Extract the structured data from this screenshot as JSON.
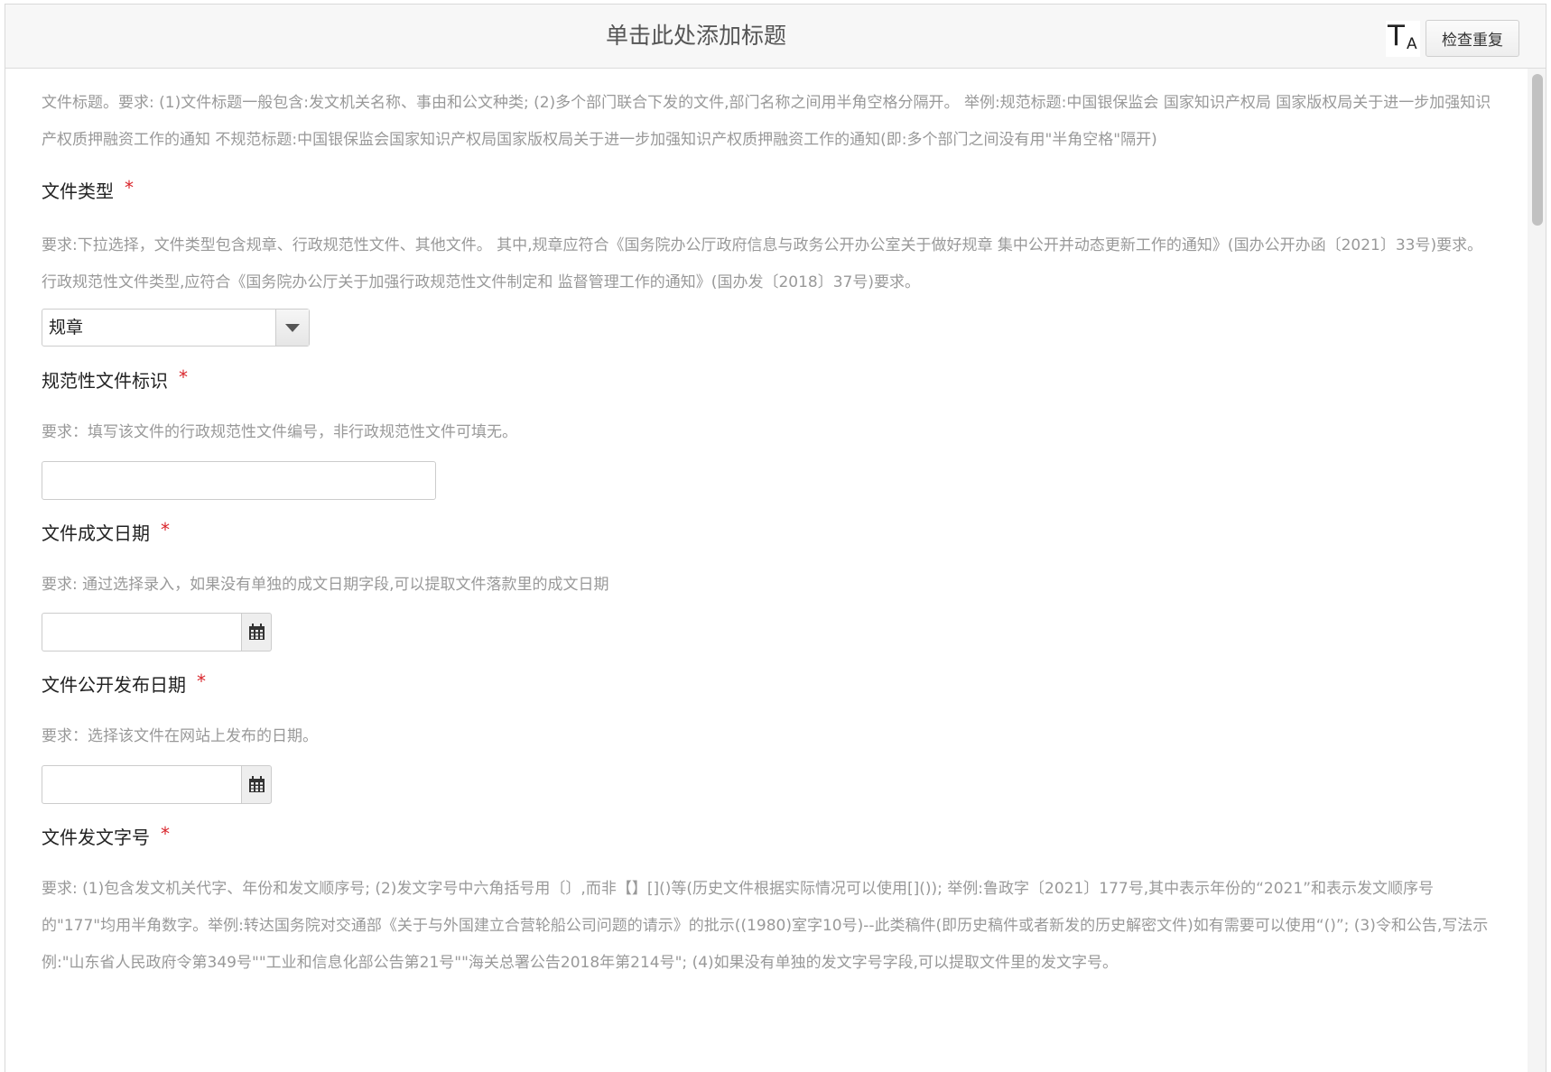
{
  "header": {
    "title": "单击此处添加标题",
    "font_toggle_big": "T",
    "font_toggle_small": "A",
    "check_duplicate_label": "检查重复"
  },
  "form": {
    "title_hint": "文件标题。要求: (1)文件标题一般包含:发文机关名称、事由和公文种类; (2)多个部门联合下发的文件,部门名称之间用半角空格分隔开。 举例:规范标题:中国银保监会 国家知识产权局 国家版权局关于进一步加强知识产权质押融资工作的通知 不规范标题:中国银保监会国家知识产权局国家版权局关于进一步加强知识产权质押融资工作的通知(即:多个部门之间没有用\"半角空格\"隔开)",
    "fields": {
      "doc_type": {
        "label": "文件类型",
        "required_mark": "*",
        "hint": "要求:下拉选择，文件类型包含规章、行政规范性文件、其他文件。 其中,规章应符合《国务院办公厅政府信息与政务公开办公室关于做好规章 集中公开并动态更新工作的通知》(国办公开办函〔2021〕33号)要求。行政规范性文件类型,应符合《国务院办公厅关于加强行政规范性文件制定和 监督管理工作的通知》(国办发〔2018〕37号)要求。",
        "selected_value": "规章"
      },
      "normative_id": {
        "label": "规范性文件标识",
        "required_mark": "*",
        "hint": "要求：填写该文件的行政规范性文件编号，非行政规范性文件可填无。",
        "value": ""
      },
      "written_date": {
        "label": "文件成文日期",
        "required_mark": "*",
        "hint": "要求: 通过选择录入，如果没有单独的成文日期字段,可以提取文件落款里的成文日期",
        "value": ""
      },
      "publish_date": {
        "label": "文件公开发布日期",
        "required_mark": "*",
        "hint": "要求：选择该文件在网站上发布的日期。",
        "value": ""
      },
      "doc_number": {
        "label": "文件发文字号",
        "required_mark": "*",
        "hint": "要求: (1)包含发文机关代字、年份和发文顺序号; (2)发文字号中六角括号用〔〕,而非【】[]()等(历史文件根据实际情况可以使用[]()); 举例:鲁政字〔2021〕177号,其中表示年份的“2021”和表示发文顺序号的\"177\"均用半角数字。举例:转达国务院对交通部《关于与外国建立合营轮船公司问题的请示》的批示((1980)室字10号)--此类稿件(即历史稿件或者新发的历史解密文件)如有需要可以使用“()”;  (3)令和公告,写法示例:\"山东省人民政府令第349号\"\"工业和信息化部公告第21号\"\"海关总署公告2018年第214号\"; (4)如果没有单独的发文字号字段,可以提取文件里的发文字号。"
      }
    }
  },
  "colors": {
    "required": "#d9262c",
    "hint_text": "#999999",
    "label_text": "#222222"
  },
  "icons": {
    "calendar": "calendar-icon",
    "dropdown": "chevron-down-icon"
  }
}
